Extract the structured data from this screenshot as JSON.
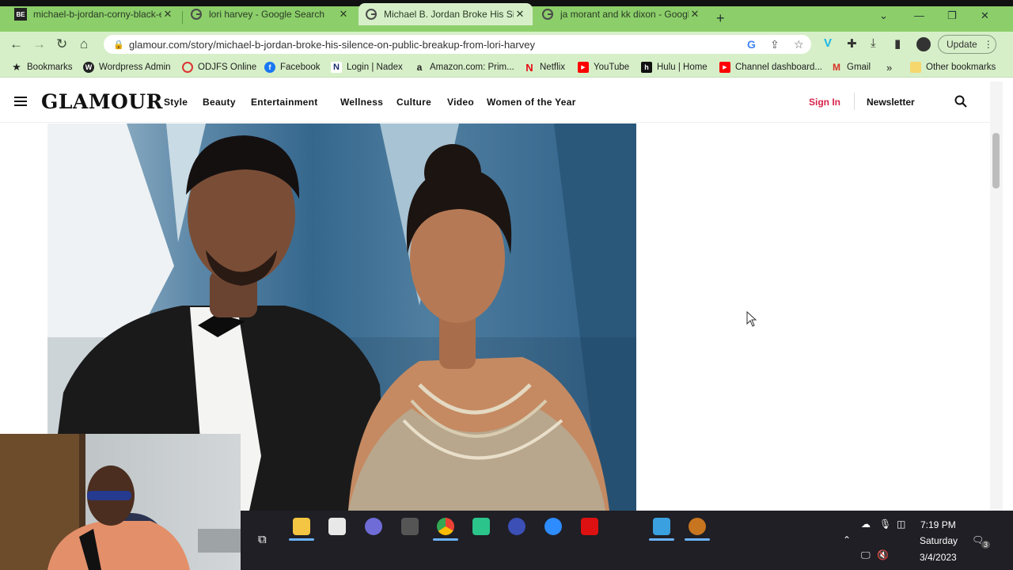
{
  "browser": {
    "tabs": [
      {
        "title": "michael-b-jordan-corny-black-e...",
        "favicon": "BE",
        "favicon_color": "#222222",
        "active": false
      },
      {
        "title": "lori harvey - Google Search",
        "favicon": "google-icon",
        "active": false
      },
      {
        "title": "Michael B. Jordan Broke His Silen",
        "favicon": "google-icon",
        "active": true
      },
      {
        "title": "ja morant and kk dixon - Google",
        "favicon": "google-icon",
        "active": false
      }
    ],
    "url": "glamour.com/story/michael-b-jordan-broke-his-silence-on-public-breakup-from-lori-harvey",
    "update_label": "Update",
    "bookmarks": [
      {
        "label": "Bookmarks",
        "icon": "star-icon"
      },
      {
        "label": "Wordpress Admin",
        "icon": "wordpress-icon"
      },
      {
        "label": "ODJFS Online",
        "icon": "circle-icon"
      },
      {
        "label": "Facebook",
        "icon": "facebook-icon"
      },
      {
        "label": "Login | Nadex",
        "icon": "nadex-icon"
      },
      {
        "label": "Amazon.com: Prim...",
        "icon": "amazon-icon"
      },
      {
        "label": "Netflix",
        "icon": "netflix-icon"
      },
      {
        "label": "YouTube",
        "icon": "youtube-icon"
      },
      {
        "label": "Hulu | Home",
        "icon": "hulu-icon"
      },
      {
        "label": "Channel dashboard...",
        "icon": "youtube-icon"
      },
      {
        "label": "Gmail",
        "icon": "gmail-icon"
      },
      {
        "label": "Other bookmarks",
        "icon": "folder-icon"
      }
    ],
    "overflow": "»"
  },
  "site": {
    "logo": "GLAMOUR",
    "nav": [
      "Style",
      "Beauty",
      "Entertainment",
      "Wellness",
      "Culture",
      "Video",
      "Women of the Year"
    ],
    "sign_in": "Sign In",
    "newsletter": "Newsletter",
    "accent_color": "#d6244b"
  },
  "taskbar": {
    "time": "7:19 PM",
    "day": "Saturday",
    "date": "3/4/2023",
    "notification_count": "3"
  }
}
